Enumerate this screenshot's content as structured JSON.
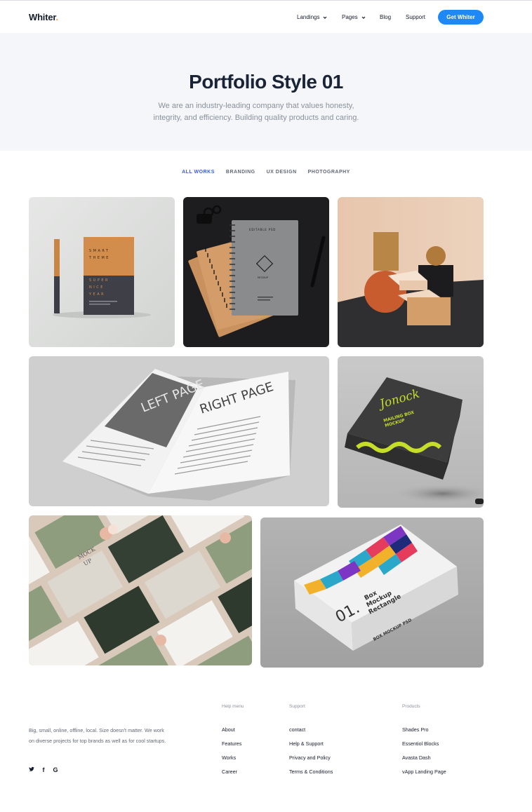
{
  "header": {
    "logo": "Whiter",
    "logo_dot": ".",
    "nav": [
      {
        "label": "Landings",
        "has_dropdown": true
      },
      {
        "label": "Pages",
        "has_dropdown": true
      },
      {
        "label": "Blog",
        "has_dropdown": false
      },
      {
        "label": "Support",
        "has_dropdown": false
      }
    ],
    "cta_label": "Get Whiter"
  },
  "hero": {
    "title": "Portfolio Style 01",
    "description": "We are an industry-leading company that values honesty, integrity, and efficiency. Building quality products and caring."
  },
  "filters": [
    {
      "label": "ALL WORKS",
      "active": true
    },
    {
      "label": "BRANDING",
      "active": false
    },
    {
      "label": "UX DESIGN",
      "active": false
    },
    {
      "label": "PHOTOGRAPHY",
      "active": false
    }
  ],
  "gallery": {
    "items": [
      {
        "subject": "book-mockup",
        "print_text": [
          "SMART",
          "THEME",
          "SUPER",
          "NICE",
          "YEAR"
        ]
      },
      {
        "subject": "notebook-mockup",
        "print_text": [
          "EDITABLE PSD",
          "MOCKUP"
        ]
      },
      {
        "subject": "geometric-shapes"
      },
      {
        "subject": "open-book-mockup",
        "print_text": [
          "LEFT PAGE",
          "RIGHT PAGE"
        ]
      },
      {
        "subject": "mailing-box-mockup",
        "print_text": [
          "Jonock",
          "MAILING BOX",
          "MOCKUP"
        ]
      },
      {
        "subject": "postcard-mockup",
        "print_text": [
          "MOCK",
          "UP"
        ]
      },
      {
        "subject": "box-mockup",
        "print_text": [
          "01.",
          "Box",
          "Mockup",
          "Rectangle",
          "BOX MOCKUP PSD"
        ]
      }
    ]
  },
  "footer": {
    "description": "Big, small, online, offline, local. Size doesn't matter. We work on diverse projects for top brands as well as for cool startups.",
    "social": [
      "twitter",
      "facebook",
      "google"
    ],
    "social_glyphs": [
      "✉",
      "f",
      "G"
    ],
    "columns": [
      {
        "heading": "Help menu",
        "links": [
          "About",
          "Features",
          "Works",
          "Career"
        ]
      },
      {
        "heading": "Support",
        "links": [
          "contact",
          "Help & Support",
          "Privacy and Policy",
          "Terms & Conditions"
        ]
      },
      {
        "heading": "Products",
        "links": [
          "Shades Pro",
          "Essentiol Blocks",
          "Avasta Dash",
          "vApp Landing Page"
        ]
      }
    ]
  },
  "colors": {
    "accent": "#1e88f5",
    "filter_active": "#3b5bdb",
    "hero_bg": "#f4f6f9",
    "text_dark": "#161c2d",
    "text_muted": "#8a909e"
  }
}
